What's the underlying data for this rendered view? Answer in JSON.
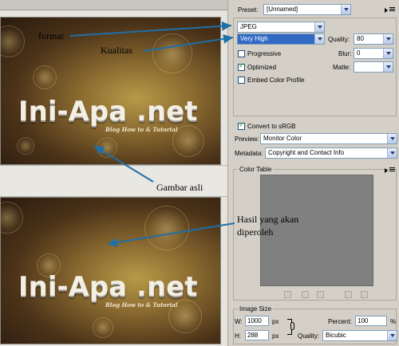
{
  "annotations": {
    "format": "format",
    "kualitas": "Kualitas",
    "gambar_asli": "Gambar asli",
    "hasil_line1": "Hasil yang akan",
    "hasil_line2": "diperoleh"
  },
  "images": {
    "logo_text": "Ini-Apa .net",
    "tagline": "Blog How to & Tutorial"
  },
  "settings": {
    "preset_label": "Preset:",
    "preset_value": "[Unnamed]",
    "format_value": "JPEG",
    "quality_preset_value": "Very High",
    "quality_label": "Quality:",
    "quality_value": "80",
    "progressive_label": "Progressive",
    "progressive_checked": false,
    "blur_label": "Blur:",
    "blur_value": "0",
    "optimized_label": "Optimized",
    "optimized_checked": true,
    "matte_label": "Matte:",
    "embed_profile_label": "Embed Color Profile",
    "embed_profile_checked": false,
    "convert_srgb_label": "Convert to sRGB",
    "convert_srgb_checked": true,
    "preview_label": "Preview:",
    "preview_value": "Monitor Color",
    "metadata_label": "Metadata:",
    "metadata_value": "Copyright and Contact Info"
  },
  "color_table": {
    "title": "Color Table",
    "swatch_color": "#808080"
  },
  "image_size": {
    "title": "Image Size",
    "w_label": "W:",
    "w_value": "1000",
    "h_label": "H:",
    "h_value": "288",
    "unit": "px",
    "percent_label": "Percent:",
    "percent_value": "100",
    "percent_unit": "%",
    "quality_label": "Quality:",
    "quality_value": "Bicubic"
  },
  "colors": {
    "panel_bg": "#d4d0c8",
    "arrow": "#1f6fa8",
    "selection": "#316ac5"
  }
}
